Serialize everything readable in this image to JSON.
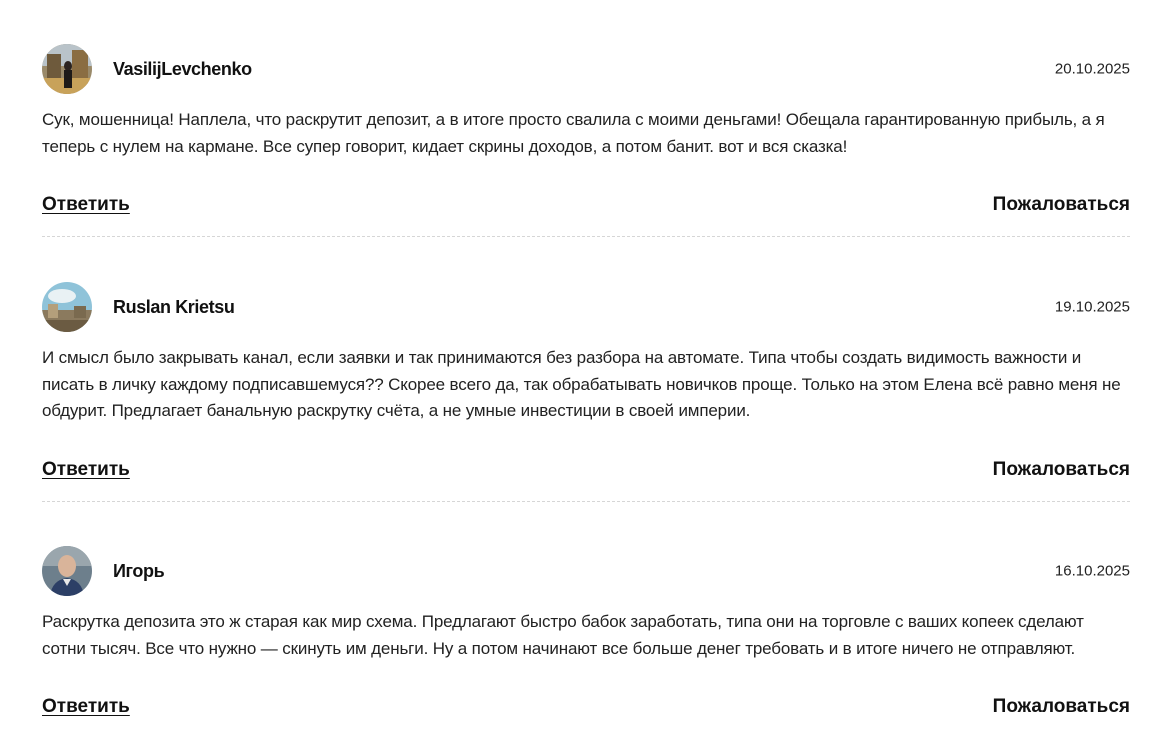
{
  "comments": [
    {
      "author": "VasilijLevchenko",
      "date": "20.10.2025",
      "text": "Сук, мошенница! Наплела, что раскрутит депозит, а в итоге просто свалила с моими деньгами! Обещала гарантированную прибыль, а я теперь с нулем на кармане. Все супер говорит, кидает скрины доходов, а потом банит. вот и вся сказка!",
      "reply_label": "Ответить",
      "report_label": "Пожаловаться"
    },
    {
      "author": "Ruslan Krietsu",
      "date": "19.10.2025",
      "text": "И смысл было закрывать канал, если заявки и так принимаются без разбора на автомате. Типа чтобы создать видимость важности и писать в личку каждому подписавшемуся?? Скорее всего да, так обрабатывать новичков проще. Только на этом Елена всё равно меня не обдурит. Предлагает банальную раскрутку счёта, а не умные инвестиции в своей империи.",
      "reply_label": "Ответить",
      "report_label": "Пожаловаться"
    },
    {
      "author": "Игорь",
      "date": "16.10.2025",
      "text": "Раскрутка депозита это ж старая как мир схема. Предлагают быстро бабок заработать, типа они на торговле с ваших копеек сделают сотни тысяч. Все что нужно — скинуть им деньги. Ну а потом начинают все больше денег требовать и в итоге ничего не отправляют.",
      "reply_label": "Ответить",
      "report_label": "Пожаловаться"
    }
  ]
}
